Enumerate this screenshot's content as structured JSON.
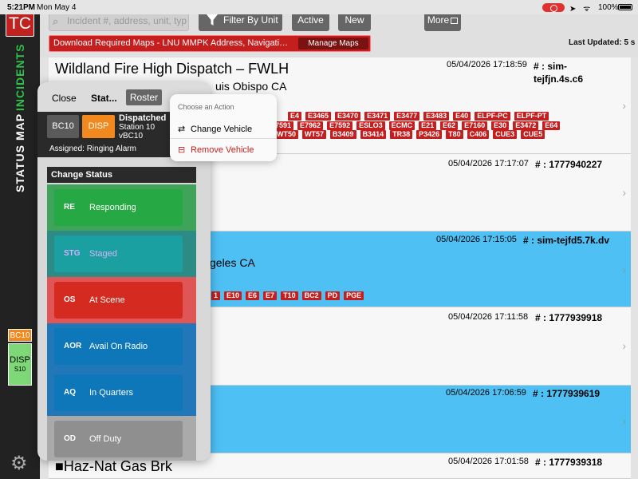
{
  "status_bar": {
    "time": "5:21PM",
    "date": "Mon May 4",
    "battery": "100%"
  },
  "app": {
    "logo": "TC"
  },
  "rail": {
    "tabs": [
      "INCIDENTS",
      "MAP",
      "STATUS"
    ],
    "unit_id": "BC10",
    "unit_status": "DISP",
    "unit_station": "S10"
  },
  "toolbar": {
    "search_placeholder": "Incident #, address, unit, type",
    "filter_label": "Filter By Unit",
    "active_label": "Active",
    "new_label": "New",
    "more_label": "More"
  },
  "banner": {
    "text": "Download Required Maps - LNU MMPK Address, Navigation M...",
    "button": "Manage Maps"
  },
  "last_updated": "Last Updated: 5 s",
  "incidents": [
    {
      "title": "Wildland Fire High Dispatch – FWLH",
      "address": "uis Obispo CA",
      "timestamp": "05/04/2026 17:18:59",
      "number": "# : sim-tejfjn.4s.c6",
      "units_row1": [
        "E4",
        "E3465",
        "E3470",
        "E3471",
        "E3477",
        "E3483",
        "E40",
        "ELPF-PC",
        "ELPF-PT"
      ],
      "units_row2": [
        "7591",
        "E7962",
        "E7592",
        "ESLO3",
        "ECMC",
        "E21",
        "E62",
        "E7160",
        "E30",
        "E3472",
        "E64"
      ],
      "units_row3": [
        "WT50",
        "WT57",
        "B3409",
        "B3414",
        "TR38",
        "P3426",
        "T80",
        "C406",
        "CUE3",
        "CUE5"
      ]
    },
    {
      "timestamp": "05/04/2026 17:17:07",
      "number": "# : 1777940227"
    },
    {
      "timestamp": "05/04/2026 17:15:05",
      "number": "# : sim-tejfd5.7k.dv",
      "address": "geles CA",
      "units": [
        "1",
        "E10",
        "E6",
        "E7",
        "T10",
        "BC2",
        "PD",
        "PGE"
      ]
    },
    {
      "timestamp": "05/04/2026 17:11:58",
      "number": "# : 1777939918"
    },
    {
      "timestamp": "05/04/2026 17:06:59",
      "number": "# : 1777939619"
    },
    {
      "title": "Haz-Nat Gas Brk",
      "timestamp": "05/04/2026 17:01:58",
      "number": "# : 1777939318"
    }
  ],
  "panel": {
    "close": "Close",
    "status_tab": "Stat...",
    "roster": "Roster",
    "unit_id": "BC10",
    "unit_status_code": "DISP",
    "unit_status_name": "Dispatched",
    "station": "Station 10",
    "vehicle": "vBC10",
    "assigned": "Assigned: Ringing Alarm",
    "change_status_header": "Change Status",
    "statuses": [
      {
        "code": "RE",
        "name": "Responding"
      },
      {
        "code": "STG",
        "name": "Staged"
      },
      {
        "code": "OS",
        "name": "At Scene"
      },
      {
        "code": "AOR",
        "name": "Avail On Radio"
      },
      {
        "code": "AQ",
        "name": "In Quarters"
      },
      {
        "code": "OD",
        "name": "Off Duty"
      }
    ]
  },
  "actions": {
    "header": "Choose an Action",
    "change_vehicle": "Change Vehicle",
    "remove_vehicle": "Remove Vehicle"
  }
}
